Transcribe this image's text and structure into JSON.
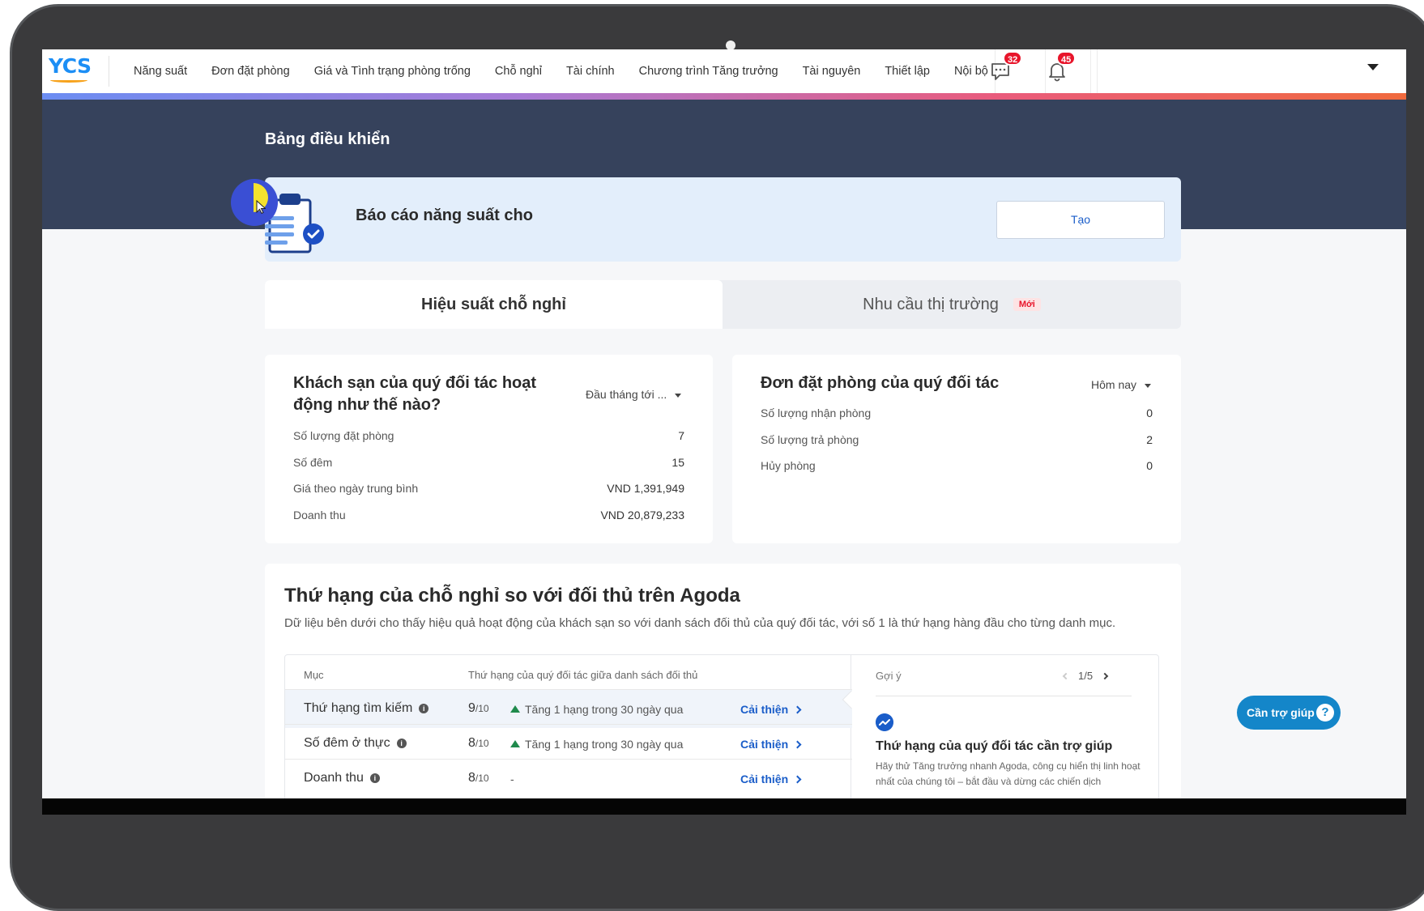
{
  "nav": {
    "logo": "YCS",
    "items": [
      "Năng suất",
      "Đơn đặt phòng",
      "Giá và Tình trạng phòng trống",
      "Chỗ nghỉ",
      "Tài chính",
      "Chương trình Tăng trưởng",
      "Tài nguyên",
      "Thiết lập",
      "Nội bộ"
    ],
    "messages_count": "32",
    "notifications_count": "45"
  },
  "header": {
    "title": "Bảng điều khiển"
  },
  "report": {
    "title": "Báo cáo năng suất cho",
    "create_label": "Tạo"
  },
  "tabs": {
    "active": "Hiệu suất chỗ nghỉ",
    "inactive": "Nhu cầu thị trường",
    "new_badge": "Mới"
  },
  "performance": {
    "title": "Khách sạn của quý đối tác hoạt động như thế nào?",
    "period": "Đầu tháng tới ...",
    "rows": [
      {
        "label": "Số lượng đặt phòng",
        "value": "7"
      },
      {
        "label": "Số đêm",
        "value": "15"
      },
      {
        "label": "Giá theo ngày trung bình",
        "value": "VND 1,391,949"
      },
      {
        "label": "Doanh thu",
        "value": "VND 20,879,233"
      }
    ]
  },
  "bookings": {
    "title": "Đơn đặt phòng của quý đối tác",
    "period": "Hôm nay",
    "rows": [
      {
        "label": "Số lượng nhận phòng",
        "value": "0"
      },
      {
        "label": "Số lượng trả phòng",
        "value": "2"
      },
      {
        "label": "Hủy phòng",
        "value": "0"
      }
    ]
  },
  "ranking": {
    "title": "Thứ hạng của chỗ nghỉ so với đối thủ trên Agoda",
    "description": "Dữ liệu bên dưới cho thấy hiệu quả hoạt động của khách sạn so với danh sách đối thủ của quý đối tác, với số 1 là thứ hạng hàng đầu cho từng danh mục.",
    "col_item": "Mục",
    "col_rank": "Thứ hạng của quý đối tác giữa danh sách đối thủ",
    "info_glyph": "i",
    "rows": [
      {
        "name": "Thứ hạng tìm kiếm",
        "score": "9",
        "out_of": "/10",
        "trend": "Tăng 1 hạng trong 30 ngày qua",
        "action": "Cải thiện"
      },
      {
        "name": "Số đêm ở thực",
        "score": "8",
        "out_of": "/10",
        "trend": "Tăng 1 hạng trong 30 ngày qua",
        "action": "Cải thiện"
      },
      {
        "name": "Doanh thu",
        "score": "8",
        "out_of": "/10",
        "trend": "-",
        "action": "Cải thiện"
      }
    ],
    "suggestion": {
      "label": "Gợi ý",
      "pager": "1/5",
      "title": "Thứ hạng của quý đối tác cần trợ giúp",
      "text": "Hãy thử Tăng trưởng nhanh Agoda, công cụ hiển thị linh hoạt nhất của chúng tôi – bắt đầu và dừng các chiến dịch"
    }
  },
  "help": {
    "label": "Cần trợ giúp",
    "glyph": "?"
  },
  "colors": {
    "band": "#36425c",
    "accent": "#1a5dc9",
    "badge": "#e8152b",
    "help": "#1486c9"
  }
}
